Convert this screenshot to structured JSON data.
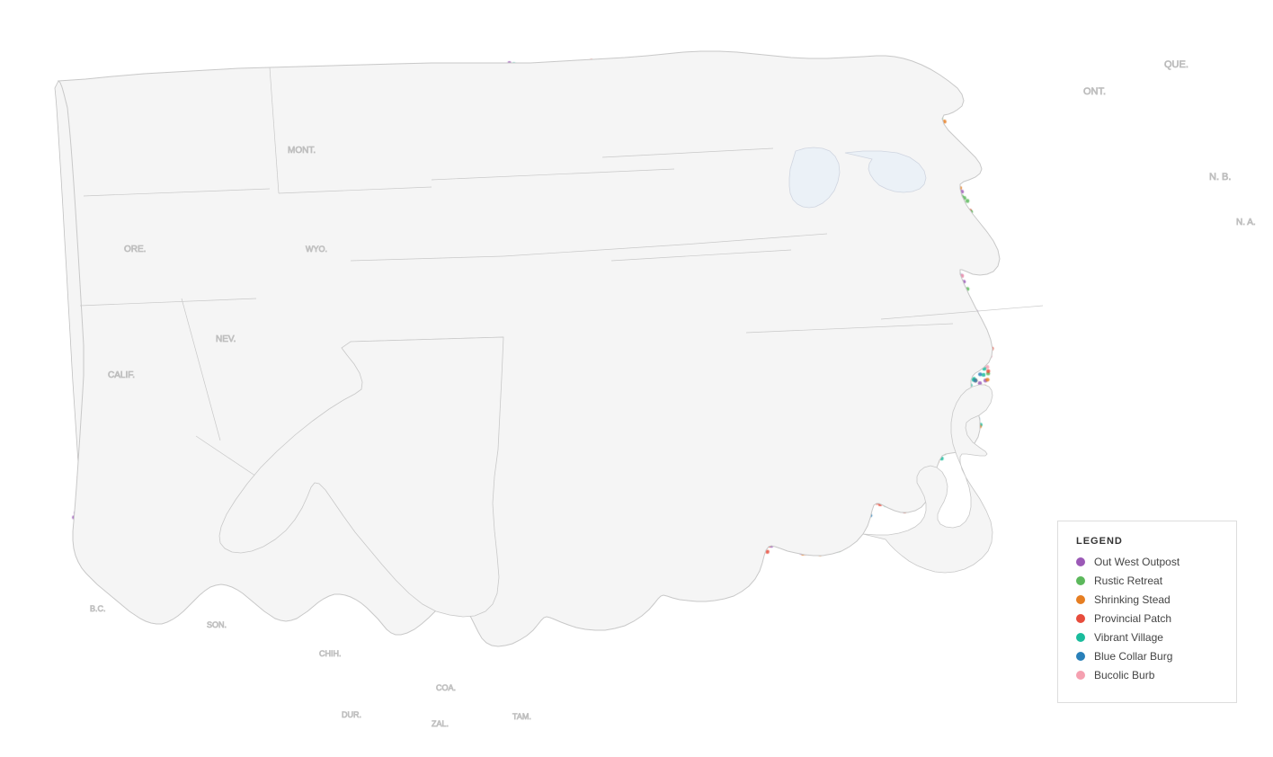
{
  "legend": {
    "title": "LEGEND",
    "items": [
      {
        "label": "Out West Outpost",
        "color": "#9b59b6",
        "id": "out-west-outpost"
      },
      {
        "label": "Rustic Retreat",
        "color": "#5cb85c",
        "id": "rustic-retreat"
      },
      {
        "label": "Shrinking Stead",
        "color": "#e67e22",
        "id": "shrinking-stead"
      },
      {
        "label": "Provincial Patch",
        "color": "#e74c3c",
        "id": "provincial-patch"
      },
      {
        "label": "Vibrant Village",
        "color": "#1abc9c",
        "id": "vibrant-village"
      },
      {
        "label": "Blue Collar Burg",
        "color": "#2980b9",
        "id": "blue-collar-burg"
      },
      {
        "label": "Bucolic Burb",
        "color": "#f5a0b0",
        "id": "bucolic-burb"
      }
    ]
  },
  "map": {
    "background": "#ffffff",
    "border_color": "#cccccc",
    "state_fill": "#f8f8f8",
    "state_stroke": "#cccccc"
  }
}
